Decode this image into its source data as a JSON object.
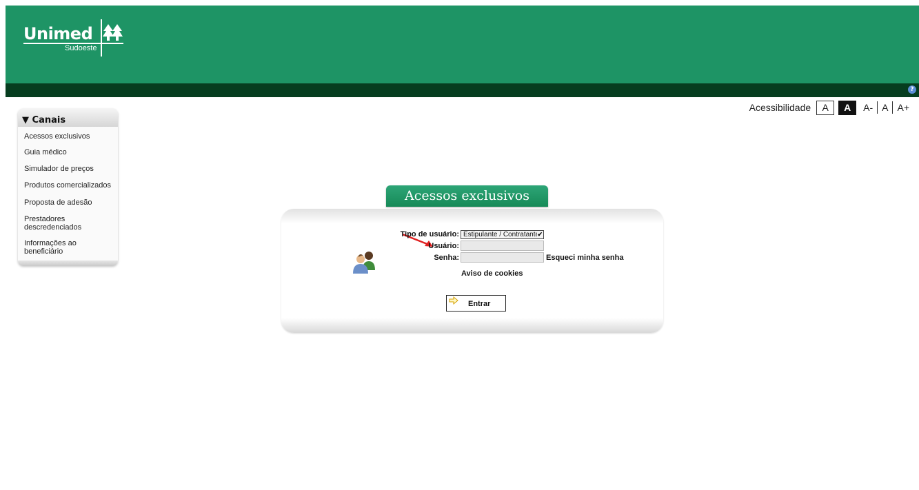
{
  "brand": {
    "name": "Unimed",
    "subtitle": "Sudoeste"
  },
  "help": {
    "icon": "help-icon",
    "glyph": "?"
  },
  "accessibility": {
    "label": "Acessibilidade",
    "contrast_normal": "A",
    "contrast_high": "A",
    "font_decrease": "A-",
    "font_default": "A",
    "font_increase": "A+"
  },
  "sidebar": {
    "title": "Canais",
    "items": [
      {
        "label": "Acessos exclusivos"
      },
      {
        "label": "Guia médico"
      },
      {
        "label": "Simulador de preços"
      },
      {
        "label": "Produtos comercializados"
      },
      {
        "label": "Proposta de adesão"
      },
      {
        "label": "Prestadores descredenciados"
      },
      {
        "label": "Informações ao beneficiário"
      }
    ]
  },
  "login": {
    "title": "Acessos exclusivos",
    "user_type_label": "Tipo de usuário:",
    "user_type_value": "Estipulante / Contratante",
    "username_label": "Usuário:",
    "username_value": "",
    "password_label": "Senha:",
    "password_value": "",
    "forgot_password": "Esqueci minha senha",
    "cookies_notice": "Aviso de cookies",
    "submit_label": "Entrar"
  },
  "colors": {
    "header_green": "#1e9465",
    "dark_bar": "#063d1f",
    "annotation_arrow": "#e02020"
  }
}
